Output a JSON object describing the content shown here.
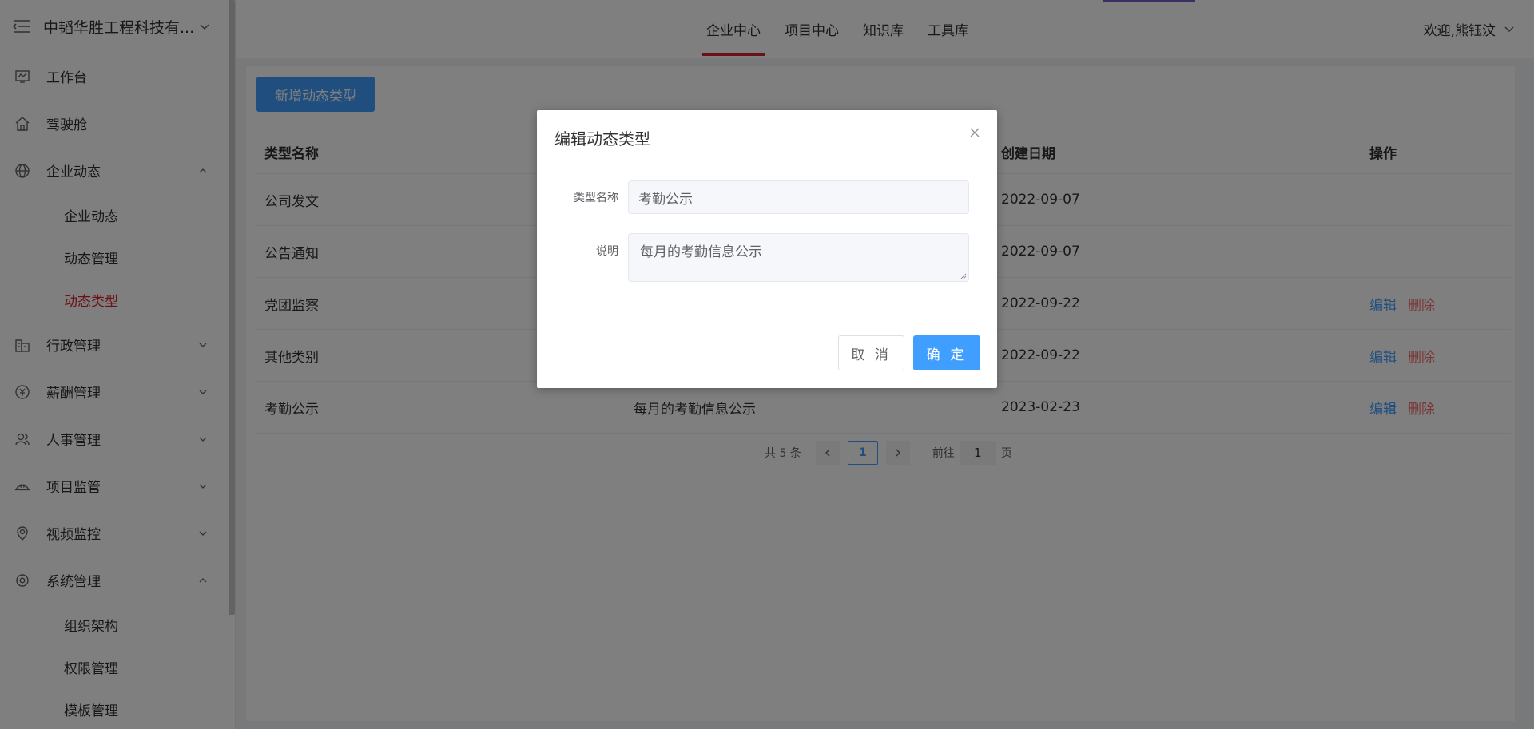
{
  "sidebar": {
    "company": "中韬华胜工程科技有...",
    "items": [
      {
        "label": "工作台"
      },
      {
        "label": "驾驶舱"
      },
      {
        "label": "企业动态"
      },
      {
        "label": "行政管理"
      },
      {
        "label": "薪酬管理"
      },
      {
        "label": "人事管理"
      },
      {
        "label": "项目监管"
      },
      {
        "label": "视频监控"
      },
      {
        "label": "系统管理"
      }
    ],
    "sub_enterprise": [
      "企业动态",
      "动态管理",
      "动态类型"
    ],
    "sub_system": [
      "组织架构",
      "权限管理",
      "模板管理"
    ]
  },
  "header": {
    "nav": [
      "企业中心",
      "项目中心",
      "知识库",
      "工具库"
    ],
    "welcome": "欢迎,熊钰汶"
  },
  "main": {
    "add_button": "新增动态类型",
    "table": {
      "headers": [
        "类型名称",
        "",
        "创建日期",
        "操作"
      ],
      "rows": [
        {
          "name": "公司发文",
          "desc": "",
          "date": "2022-09-07",
          "edit": "",
          "del": ""
        },
        {
          "name": "公告通知",
          "desc": "",
          "date": "2022-09-07",
          "edit": "",
          "del": ""
        },
        {
          "name": "党团监察",
          "desc": "",
          "date": "2022-09-22",
          "edit": "编辑",
          "del": "删除"
        },
        {
          "name": "其他类别",
          "desc": "",
          "date": "2022-09-22",
          "edit": "编辑",
          "del": "删除"
        },
        {
          "name": "考勤公示",
          "desc": "每月的考勤信息公示",
          "date": "2023-02-23",
          "edit": "编辑",
          "del": "删除"
        }
      ]
    },
    "pagination": {
      "total": "共 5 条",
      "current": "1",
      "goto_prefix": "前往",
      "goto_value": "1",
      "goto_suffix": "页"
    }
  },
  "dialog": {
    "title": "编辑动态类型",
    "name_label": "类型名称",
    "name_value": "考勤公示",
    "desc_label": "说明",
    "desc_value": "每月的考勤信息公示",
    "cancel": "取 消",
    "ok": "确 定"
  },
  "colors": {
    "primary": "#409eff",
    "active_red": "#d9232e",
    "danger": "#f56c6c"
  }
}
